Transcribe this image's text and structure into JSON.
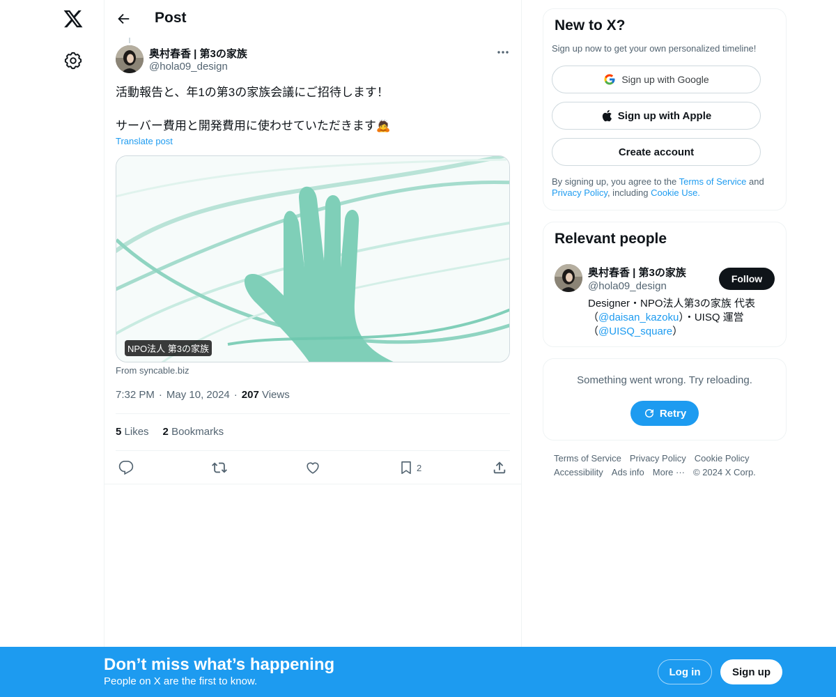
{
  "nav": {
    "logo_icon": "x-logo-icon",
    "settings_icon": "gear-icon"
  },
  "header": {
    "title": "Post"
  },
  "post": {
    "author_name": "奥村春香 | 第3の家族",
    "author_handle": "@hola09_design",
    "text_line1": "活動報告と、年1の第3の家族会議にご招待します！",
    "text_line2": "サーバー費用と開発費用に使わせていただきます🙇",
    "translate": "Translate post",
    "card_label": "NPO法人 第3の家族",
    "card_source": "From syncable.biz",
    "time": "7:32 PM",
    "date": "May 10, 2024",
    "views_count": "207",
    "views_label": "Views",
    "likes_count": "5",
    "likes_label": "Likes",
    "bookmarks_count": "2",
    "bookmarks_label": "Bookmarks",
    "bookmark_action_count": "2"
  },
  "signup_card": {
    "title": "New to X?",
    "subtitle": "Sign up now to get your own personalized timeline!",
    "google": "Sign up with Google",
    "apple": "Sign up with Apple",
    "create": "Create account",
    "legal_1": "By signing up, you agree to the ",
    "legal_terms": "Terms of Service",
    "legal_2": " and ",
    "legal_privacy": "Privacy Policy",
    "legal_3": ", including ",
    "legal_cookie": "Cookie Use."
  },
  "relevant": {
    "title": "Relevant people",
    "name": "奥村春香 | 第3の家族",
    "handle": "@hola09_design",
    "follow": "Follow",
    "bio_1": "Designer・NPO法人第3の家族 代表（",
    "bio_link1": "@daisan_kazoku",
    "bio_2": "）・UISQ 運営（",
    "bio_link2": "@UISQ_square",
    "bio_3": "）"
  },
  "error_card": {
    "message": "Something went wrong. Try reloading.",
    "retry": "Retry"
  },
  "footer": {
    "links": [
      "Terms of Service",
      "Privacy Policy",
      "Cookie Policy",
      "Accessibility",
      "Ads info",
      "More ···",
      "© 2024 X Corp."
    ]
  },
  "bottom_bar": {
    "title": "Don’t miss what’s happening",
    "subtitle": "People on X are the first to know.",
    "login": "Log in",
    "signup": "Sign up"
  },
  "colors": {
    "accent": "#1d9bf0",
    "text": "#0f1419",
    "muted": "#536471",
    "card_hand": "#7fcfb8"
  }
}
